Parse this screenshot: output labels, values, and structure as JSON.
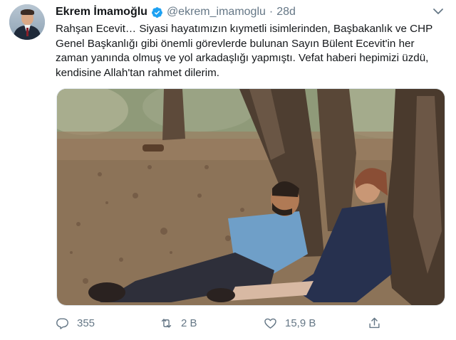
{
  "tweet": {
    "author_name": "Ekrem İmamoğlu",
    "handle": "@ekrem_imamoglu",
    "separator": "·",
    "time": "28d",
    "text_lines": [
      "Rahşan Ecevit… Siyasi hayatımızın kıymetli isimlerinden, Başbakanlık ve CHP",
      "Genel Başkanlığı gibi önemli görevlerde bulunan Sayın Bülent Ecevit'in her",
      "zaman yanında olmuş ve yol arkadaşlığı yapmıştı. Vefat haberi hepimizi üzdü,",
      "kendisine Allah'tan rahmet dilerim."
    ],
    "icons": {
      "verified": "verified-badge-icon",
      "more": "chevron-down-icon",
      "reply": "reply-icon",
      "retweet": "retweet-icon",
      "like": "heart-icon",
      "share": "share-icon"
    }
  },
  "actions": {
    "reply_count": "355",
    "retweet_count": "2 B",
    "like_count": "15,9 B"
  },
  "colors": {
    "text": "#14171a",
    "secondary": "#657786",
    "verified": "#1da1f2"
  }
}
